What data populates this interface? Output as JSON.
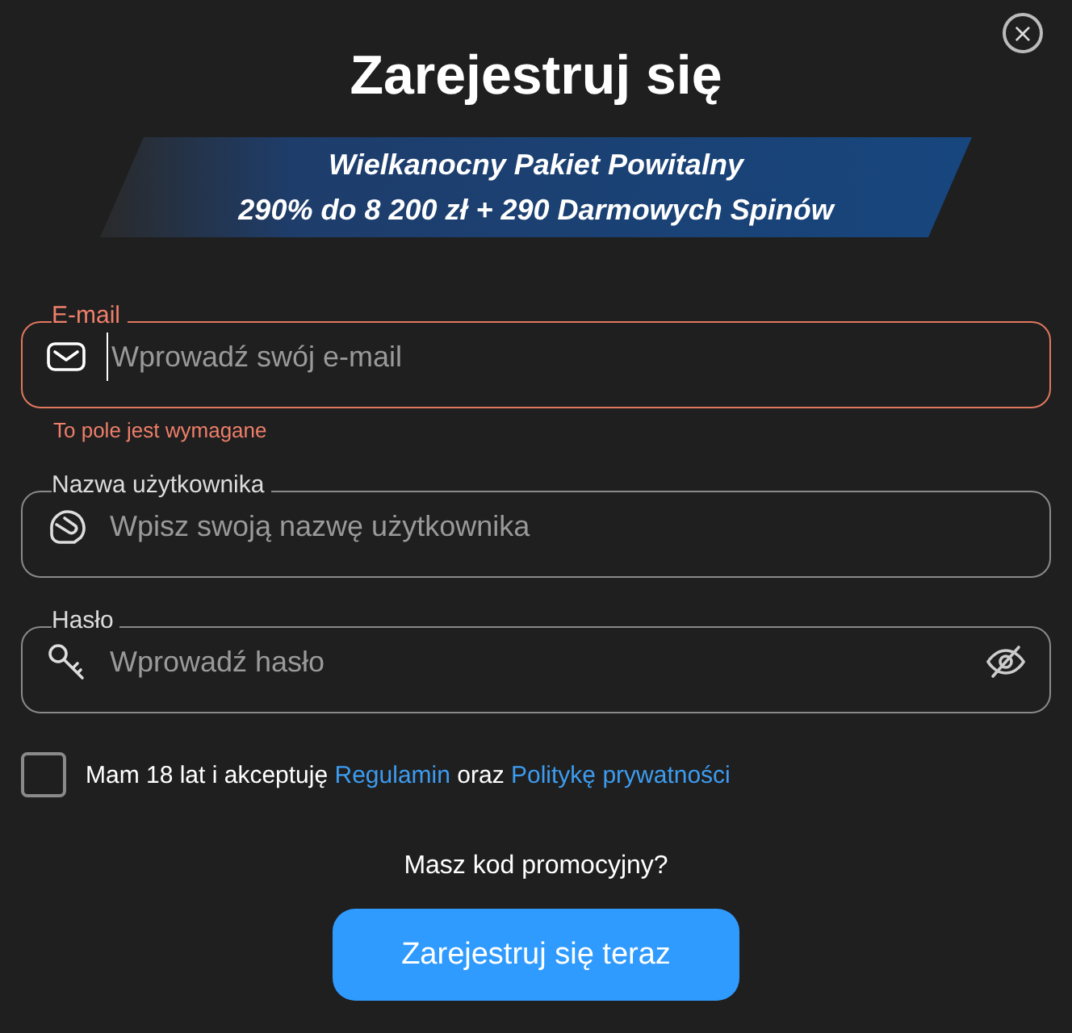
{
  "dialog": {
    "title": "Zarejestruj się",
    "close": "×"
  },
  "banner": {
    "line_1": "Wielkanocny Pakiet Powitalny",
    "line_2": "290% do 8 200 zł + 290 Darmowych Spinów"
  },
  "fields": [
    {
      "kind": "email",
      "label": "E-mail",
      "placeholder": "Wprowadź swój e-mail",
      "invalid": true,
      "focused": true,
      "error": "To pole jest wymagane"
    },
    {
      "kind": "username",
      "label": "Nazwa użytkownika",
      "placeholder": "Wpisz swoją nazwę użytkownika",
      "invalid": false,
      "focused": false
    },
    {
      "kind": "password",
      "label": "Hasło",
      "placeholder": "Wprowadź hasło",
      "invalid": false,
      "focused": false
    }
  ],
  "consent": {
    "checked": false,
    "text_1": "Mam 18 lat i akceptuję",
    "link_1": "Regulamin",
    "text_2": "oraz",
    "link_2": "Politykę prywatności"
  },
  "promo": "Masz kod promocyjny?",
  "submit": "Zarejestruj się teraz"
}
